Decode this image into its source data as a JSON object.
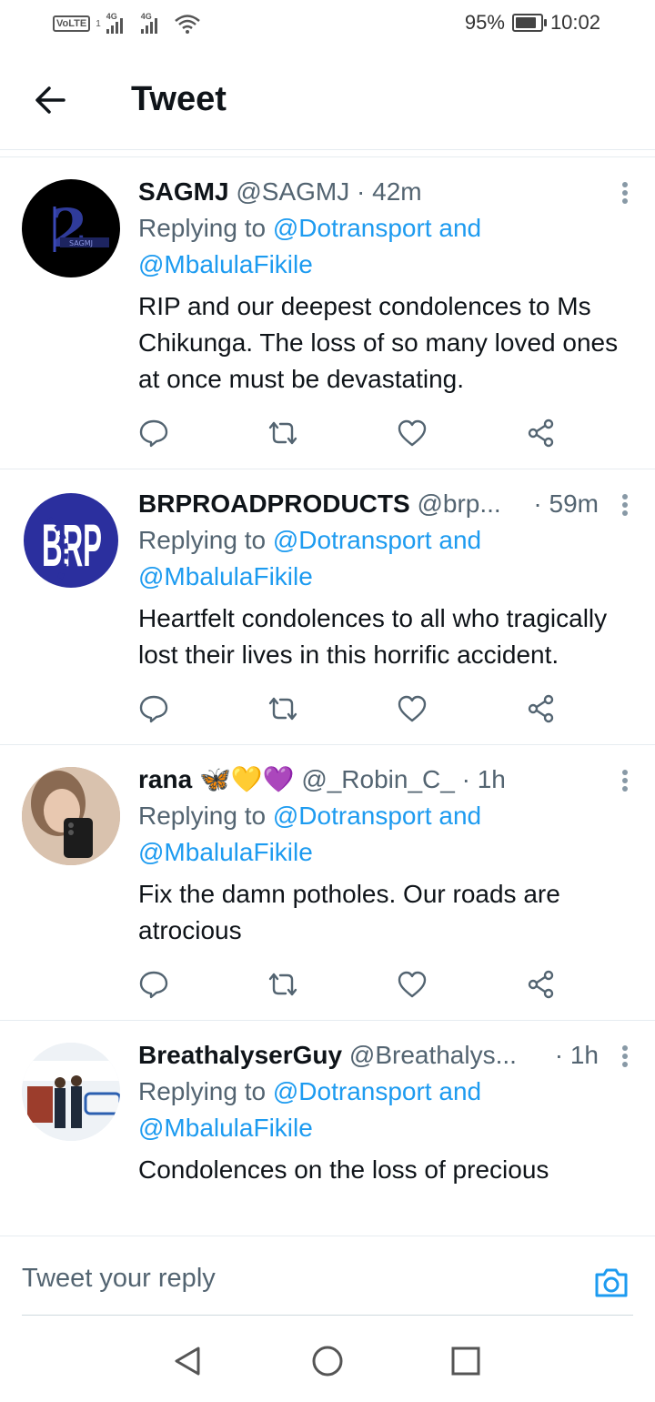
{
  "status_bar": {
    "volte": "VoLTE",
    "sim": "1",
    "network_1": "4G",
    "network_2": "4G",
    "battery": "95%",
    "time": "10:02"
  },
  "header": {
    "title": "Tweet"
  },
  "tweets": [
    {
      "name": "SAGMJ",
      "handle": "@SAGMJ",
      "time": "· 42m",
      "replying_prefix": "Replying to ",
      "reply_to_1": "@Dotransport and",
      "reply_to_2": "@MbalulaFikile",
      "text": "RIP and our deepest condolences to Ms Chikunga. The loss of so many loved ones at once must be devastating.",
      "avatar_text": "SAGMJ"
    },
    {
      "name": "BRPROADPRODUCTS",
      "handle": "@brp...",
      "time": "· 59m",
      "replying_prefix": "Replying to ",
      "reply_to_1": "@Dotransport and",
      "reply_to_2": "@MbalulaFikile",
      "text": "Heartfelt condolences to all who tragically lost their lives in this horrific accident.",
      "avatar_text": "BRP"
    },
    {
      "name": "rana",
      "emoji": "🦋💛💜",
      "handle": "@_Robin_C_",
      "time": "· 1h",
      "replying_prefix": "Replying to ",
      "reply_to_1": "@Dotransport and",
      "reply_to_2": "@MbalulaFikile",
      "text": "Fix the damn potholes. Our roads are atrocious"
    },
    {
      "name": "BreathalyserGuy",
      "handle": "@Breathalys...",
      "time": "· 1h",
      "replying_prefix": "Replying to ",
      "reply_to_1": "@Dotransport and",
      "reply_to_2": "@MbalulaFikile",
      "text": "Condolences on the loss of precious"
    }
  ],
  "composer": {
    "placeholder": "Tweet your reply"
  },
  "colors": {
    "link": "#1d9bf0",
    "text": "#0f1419",
    "secondary": "#536471"
  }
}
